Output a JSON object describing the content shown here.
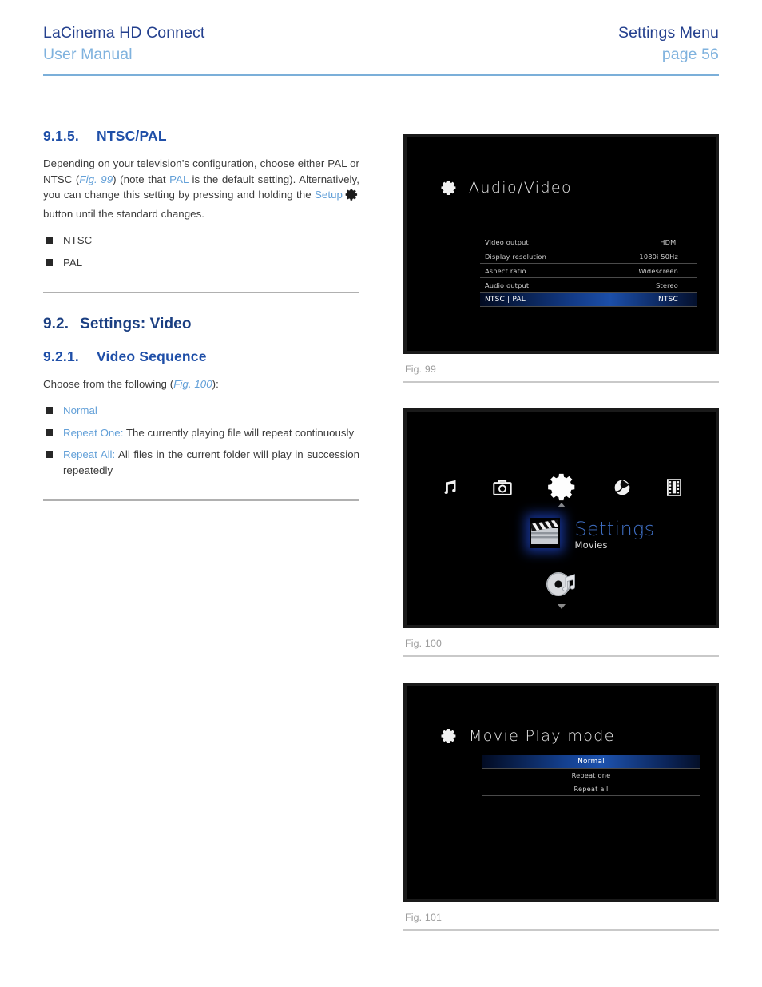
{
  "header": {
    "product_title": "LaCinema HD Connect",
    "document_type": "User Manual",
    "section_label": "Settings Menu",
    "page_label": "page 56"
  },
  "sections": {
    "ntsc_pal": {
      "number": "9.1.5.",
      "title": "NTSC/PAL",
      "body_parts": {
        "p1": "Depending on your television’s configuration, choose either PAL or NTSC (",
        "link_fig99": "Fig. 99",
        "p2": ") (note that ",
        "link_pal": "PAL",
        "p3": " is the default setting). Alternatively, you can change this setting by pressing and holding the ",
        "link_setup": "Setup",
        "p4": " button until the standard changes."
      },
      "bullets": [
        {
          "label": "NTSC",
          "desc": ""
        },
        {
          "label": "PAL",
          "desc": ""
        }
      ]
    },
    "settings_video": {
      "number": "9.2.",
      "title": "Settings: Video"
    },
    "video_sequence": {
      "number": "9.2.1.",
      "title": "Video Sequence",
      "intro_pre": "Choose from the following (",
      "intro_link": "Fig. 100",
      "intro_post": "):",
      "bullets": [
        {
          "label": "Normal",
          "desc": ""
        },
        {
          "label": "Repeat One:",
          "desc": " The currently playing file will repeat continuously"
        },
        {
          "label": "Repeat All:",
          "desc": " All files in the current folder will play in succession repeatedly"
        }
      ]
    }
  },
  "figures": [
    {
      "caption": "Fig. 99",
      "kind": "settings-table",
      "screen_title": "Audio/Video",
      "rows": [
        {
          "key": "Video output",
          "value": "HDMI",
          "selected": false
        },
        {
          "key": "Display resolution",
          "value": "1080i 50Hz",
          "selected": false
        },
        {
          "key": "Aspect ratio",
          "value": "Widescreen",
          "selected": false
        },
        {
          "key": "Audio output",
          "value": "Stereo",
          "selected": false
        },
        {
          "key": "NTSC | PAL",
          "value": "NTSC",
          "selected": true
        }
      ]
    },
    {
      "caption": "Fig. 100",
      "kind": "carousel",
      "icons": [
        {
          "name": "music-note-icon",
          "label": "Music"
        },
        {
          "name": "camera-icon",
          "label": "Photos"
        },
        {
          "name": "gear-icon",
          "label": "Settings"
        },
        {
          "name": "beach-ball-icon",
          "label": "Internet"
        },
        {
          "name": "film-strip-icon",
          "label": "Movies"
        }
      ],
      "selected_title": "Settings",
      "selected_subtitle": "Movies",
      "selected_icon": "clapper-board-icon",
      "below_icon": "disc-music-icon"
    },
    {
      "caption": "Fig. 101",
      "kind": "settings-list",
      "screen_title": "Movie Play mode",
      "rows": [
        {
          "key": "Normal",
          "value": "",
          "selected": true
        },
        {
          "key": "Repeat one",
          "value": "",
          "selected": false
        },
        {
          "key": "Repeat all",
          "value": "",
          "selected": false
        }
      ]
    }
  ],
  "colors": {
    "header_rule": "#7bafd9",
    "title_navy": "#24408e",
    "subtitle_blue": "#7fb2de",
    "link_blue": "#63a0d8",
    "section_blue": "#1f4fa8",
    "caption_gray": "#9b9b9b",
    "selection_blue": "#1b4ea8"
  }
}
